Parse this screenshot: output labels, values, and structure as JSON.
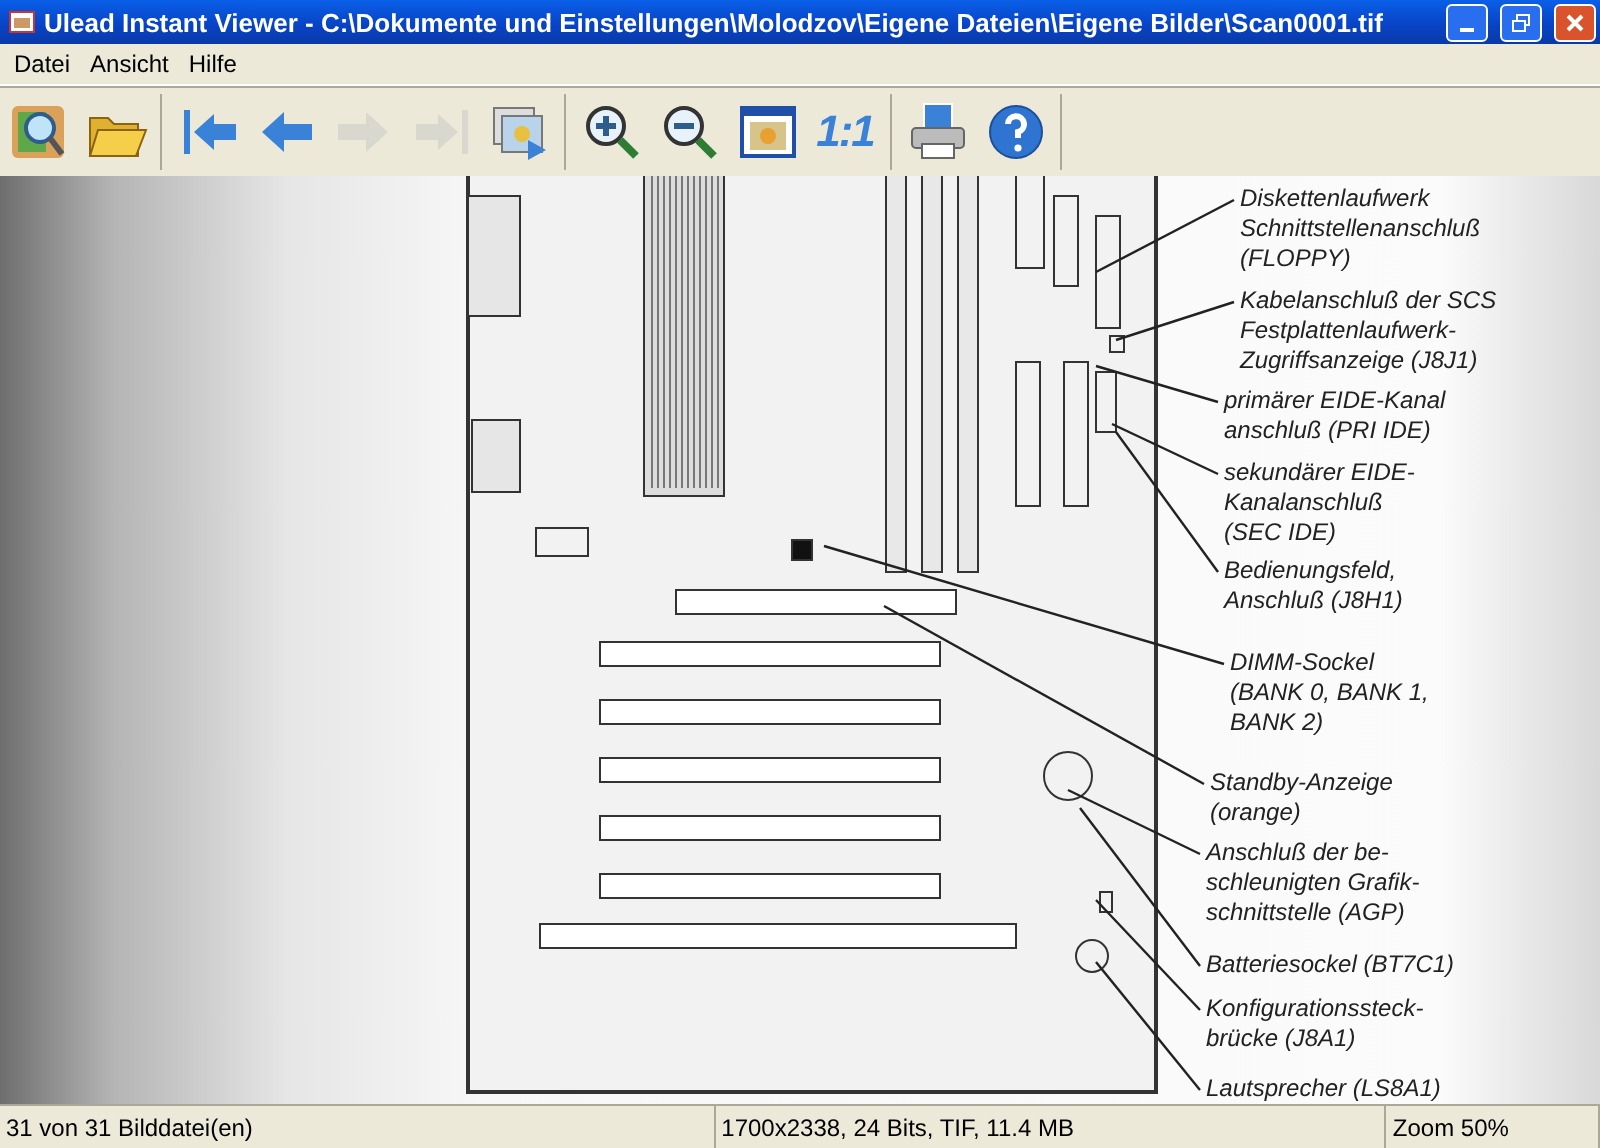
{
  "window": {
    "title": "Ulead Instant Viewer - C:\\Dokumente und Einstellungen\\Molodzov\\Eigene Dateien\\Eigene Bilder\\Scan0001.tif"
  },
  "menu": [
    "Datei",
    "Ansicht",
    "Hilfe"
  ],
  "toolbar": [
    [
      {
        "disabled": false
      },
      {
        "disabled": false
      }
    ],
    [
      {
        "disabled": false
      },
      {
        "disabled": false
      },
      {
        "disabled": true
      },
      {
        "disabled": true
      },
      {
        "disabled": false
      }
    ],
    [
      {
        "disabled": false
      },
      {
        "disabled": false
      },
      {
        "disabled": false
      },
      {
        "disabled": false,
        "label": "1:1"
      }
    ],
    [
      {
        "disabled": false
      },
      {
        "disabled": false
      }
    ]
  ],
  "scan": {
    "labels": [
      {
        "lines": [
          "Diskettenlaufwerk",
          "Schnittstellenanschluß",
          "(FLOPPY)"
        ]
      },
      {
        "lines": [
          "Kabelanschluß der SCS",
          "Festplattenlaufwerk-",
          "Zugriffsanzeige (J8J1)"
        ]
      },
      {
        "lines": [
          "primärer EIDE-Kanal",
          "anschluß (PRI IDE)"
        ]
      },
      {
        "lines": [
          "sekundärer EIDE-",
          "Kanalanschluß",
          "(SEC IDE)"
        ]
      },
      {
        "lines": [
          "Bedienungsfeld,",
          "Anschluß (J8H1)"
        ]
      },
      {
        "lines": [
          "DIMM-Sockel",
          "(BANK 0, BANK 1,",
          "BANK 2)"
        ]
      },
      {
        "lines": [
          "Standby-Anzeige",
          "(orange)"
        ]
      },
      {
        "lines": [
          "Anschluß der be-",
          "schleunigten Grafik-",
          "schnittstelle (AGP)"
        ]
      },
      {
        "lines": [
          "Batteriesockel (BT7C1)"
        ]
      },
      {
        "lines": [
          "Konfigurationssteck-",
          "brücke (J8A1)"
        ]
      },
      {
        "lines": [
          "Lautsprecher (LS8A1)"
        ]
      }
    ]
  },
  "status_bar": [
    "31 von 31 Bilddatei(en)",
    "1700x2338, 24 Bits, TIF, 11.4 MB",
    "Zoom 50%"
  ]
}
